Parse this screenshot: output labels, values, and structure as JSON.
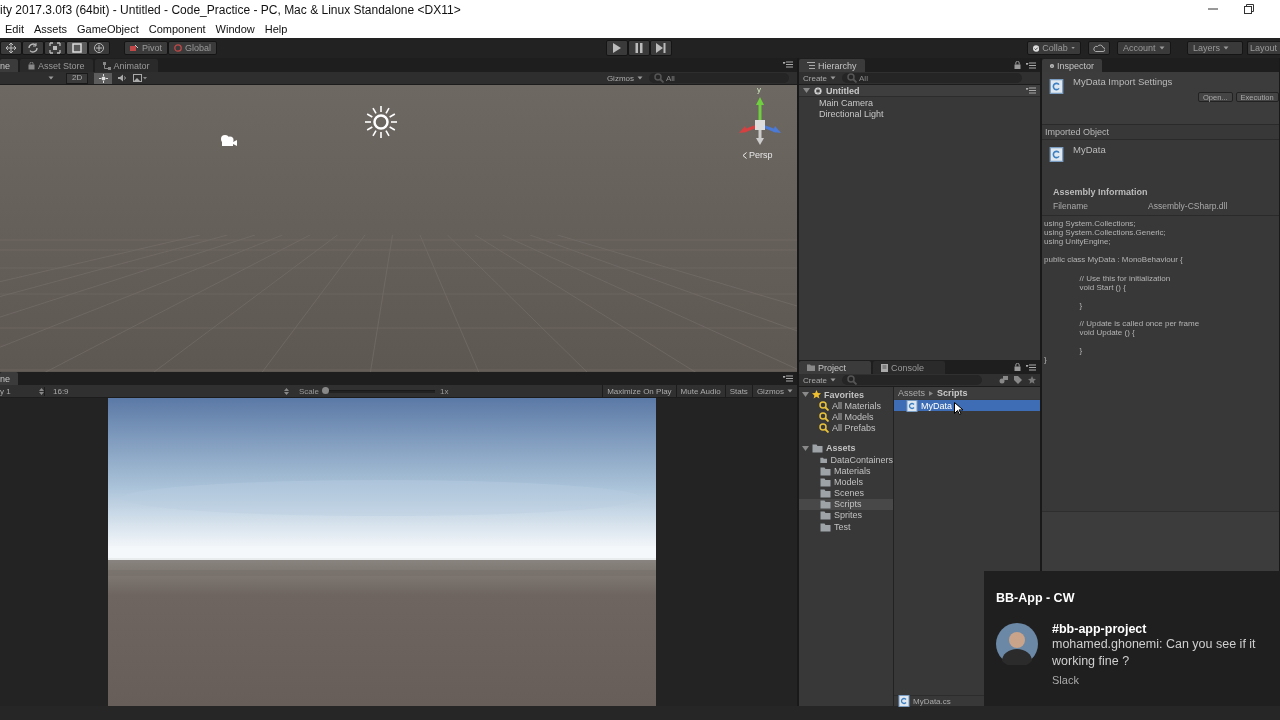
{
  "window": {
    "title": "ity 2017.3.0f3 (64bit) - Untitled - Code_Practice - PC, Mac & Linux Standalone <DX11>"
  },
  "menu": [
    "Edit",
    "Assets",
    "GameObject",
    "Component",
    "Window",
    "Help"
  ],
  "toolbar": {
    "pivot": "Pivot",
    "global": "Global",
    "collab": "Collab",
    "account": "Account",
    "layers": "Layers",
    "layout": "Layout"
  },
  "scene": {
    "tabs": [
      {
        "label": "ne",
        "selected": true
      },
      {
        "label": "Asset Store",
        "selected": false
      },
      {
        "label": "Animator",
        "selected": false
      }
    ],
    "mode_2d": "2D",
    "lighting": {
      "on": true
    },
    "gizmos": "Gizmos",
    "search_placeholder": "All",
    "axis_label": "y",
    "projection": "Persp"
  },
  "game": {
    "tab": "ne",
    "display": "y 1",
    "aspect": "16:9",
    "scale_label": "Scale",
    "scale": {
      "level": 0
    },
    "scale_value": "1x",
    "buttons": [
      "Maximize On Play",
      "Mute Audio",
      "Stats",
      "Gizmos"
    ]
  },
  "hierarchy": {
    "tab": "Hierarchy",
    "create": "Create",
    "search_placeholder": "All",
    "scene": "Untitled",
    "items": [
      "Main Camera",
      "Directional Light"
    ]
  },
  "project": {
    "tabs": [
      {
        "label": "Project",
        "selected": true
      },
      {
        "label": "Console",
        "selected": false
      }
    ],
    "create": "Create",
    "favorites": {
      "label": "Favorites",
      "expanded": true,
      "children": [
        "All Materials",
        "All Models",
        "All Prefabs"
      ]
    },
    "assets": {
      "label": "Assets",
      "expanded": true,
      "children": [
        {
          "label": "DataContainers",
          "selected": false
        },
        {
          "label": "Materials",
          "selected": false
        },
        {
          "label": "Models",
          "selected": false
        },
        {
          "label": "Scenes",
          "selected": false
        },
        {
          "label": "Scripts",
          "selected": true
        },
        {
          "label": "Sprites",
          "selected": false
        },
        {
          "label": "Test",
          "selected": false
        }
      ]
    },
    "breadcrumb": [
      "Assets",
      "Scripts"
    ],
    "files": [
      {
        "name": "MyData",
        "selected": true
      }
    ],
    "footer": "MyData.cs"
  },
  "inspector": {
    "tab": "Inspector",
    "title": "MyData Import Settings",
    "buttons": [
      "Open...",
      "Execution"
    ],
    "imported_heading": "Imported Object",
    "imported_name": "MyData",
    "assembly_heading": "Assembly Information",
    "filename_label": "Filename",
    "filename_value": "Assembly-CSharp.dll",
    "code": "using System.Collections;\nusing System.Collections.Generic;\nusing UnityEngine;\n\npublic class MyData : MonoBehaviour {\n\n\t// Use this for initialization\n\tvoid Start () {\n\t\t\n\t}\n\t\n\t// Update is called once per frame\n\tvoid Update () {\n\t\t\n\t}\n}"
  },
  "notification": {
    "app": "BB-App - CW",
    "channel": "#bb-app-project",
    "message": "mohamed.ghonemi: Can you see if it working fine ?",
    "source": "Slack"
  }
}
